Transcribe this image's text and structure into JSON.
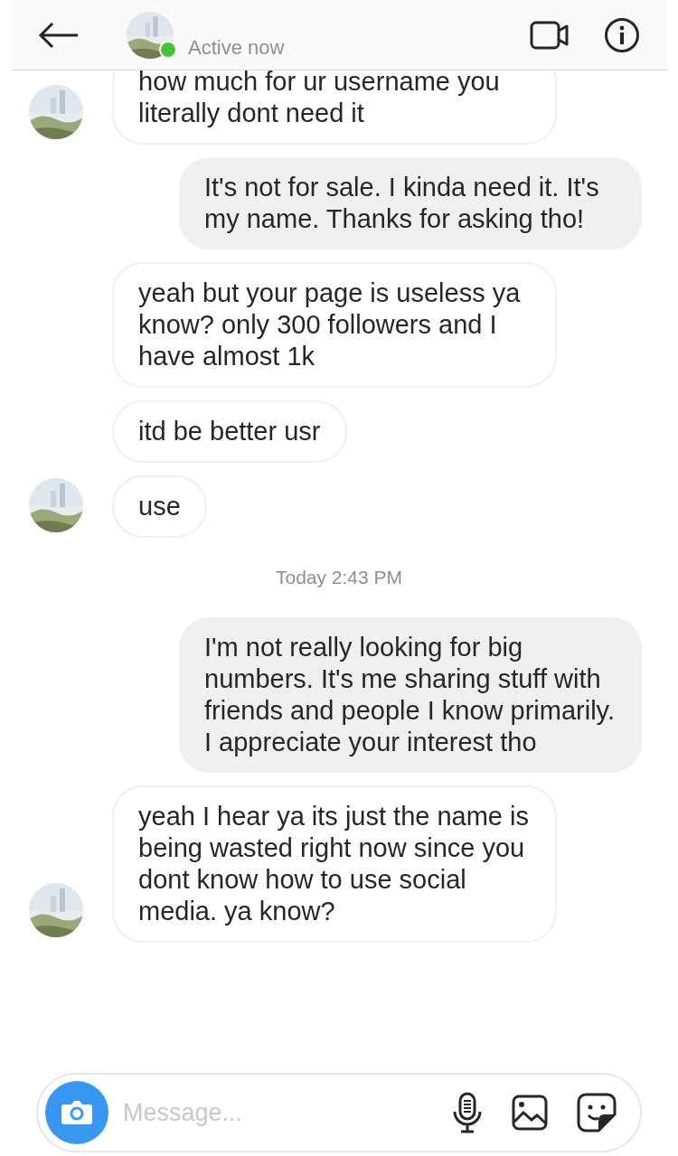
{
  "header": {
    "status": "Active now",
    "online": true
  },
  "messages": [
    {
      "kind": "received",
      "text": "how much for ur username you literally dont need it",
      "show_avatar": true
    },
    {
      "kind": "sent",
      "text": "It's not for sale. I kinda need it. It's my name. Thanks for asking tho!"
    },
    {
      "kind": "received",
      "text": "yeah but your page is useless ya know? only 300 followers and I have almost 1k",
      "show_avatar": false
    },
    {
      "kind": "received",
      "text": "itd be better usr",
      "show_avatar": false
    },
    {
      "kind": "received",
      "text": "use",
      "show_avatar": true
    },
    {
      "kind": "timestamp",
      "text": "Today 2:43 PM"
    },
    {
      "kind": "sent",
      "text": "I'm not really looking for big numbers. It's me sharing stuff with friends and people I know primarily. I appreciate your interest tho"
    },
    {
      "kind": "received",
      "text": "yeah I hear ya its just the name is being wasted right now since you dont know how to use social media. ya know?",
      "show_avatar": true
    }
  ],
  "composer": {
    "placeholder": "Message..."
  }
}
